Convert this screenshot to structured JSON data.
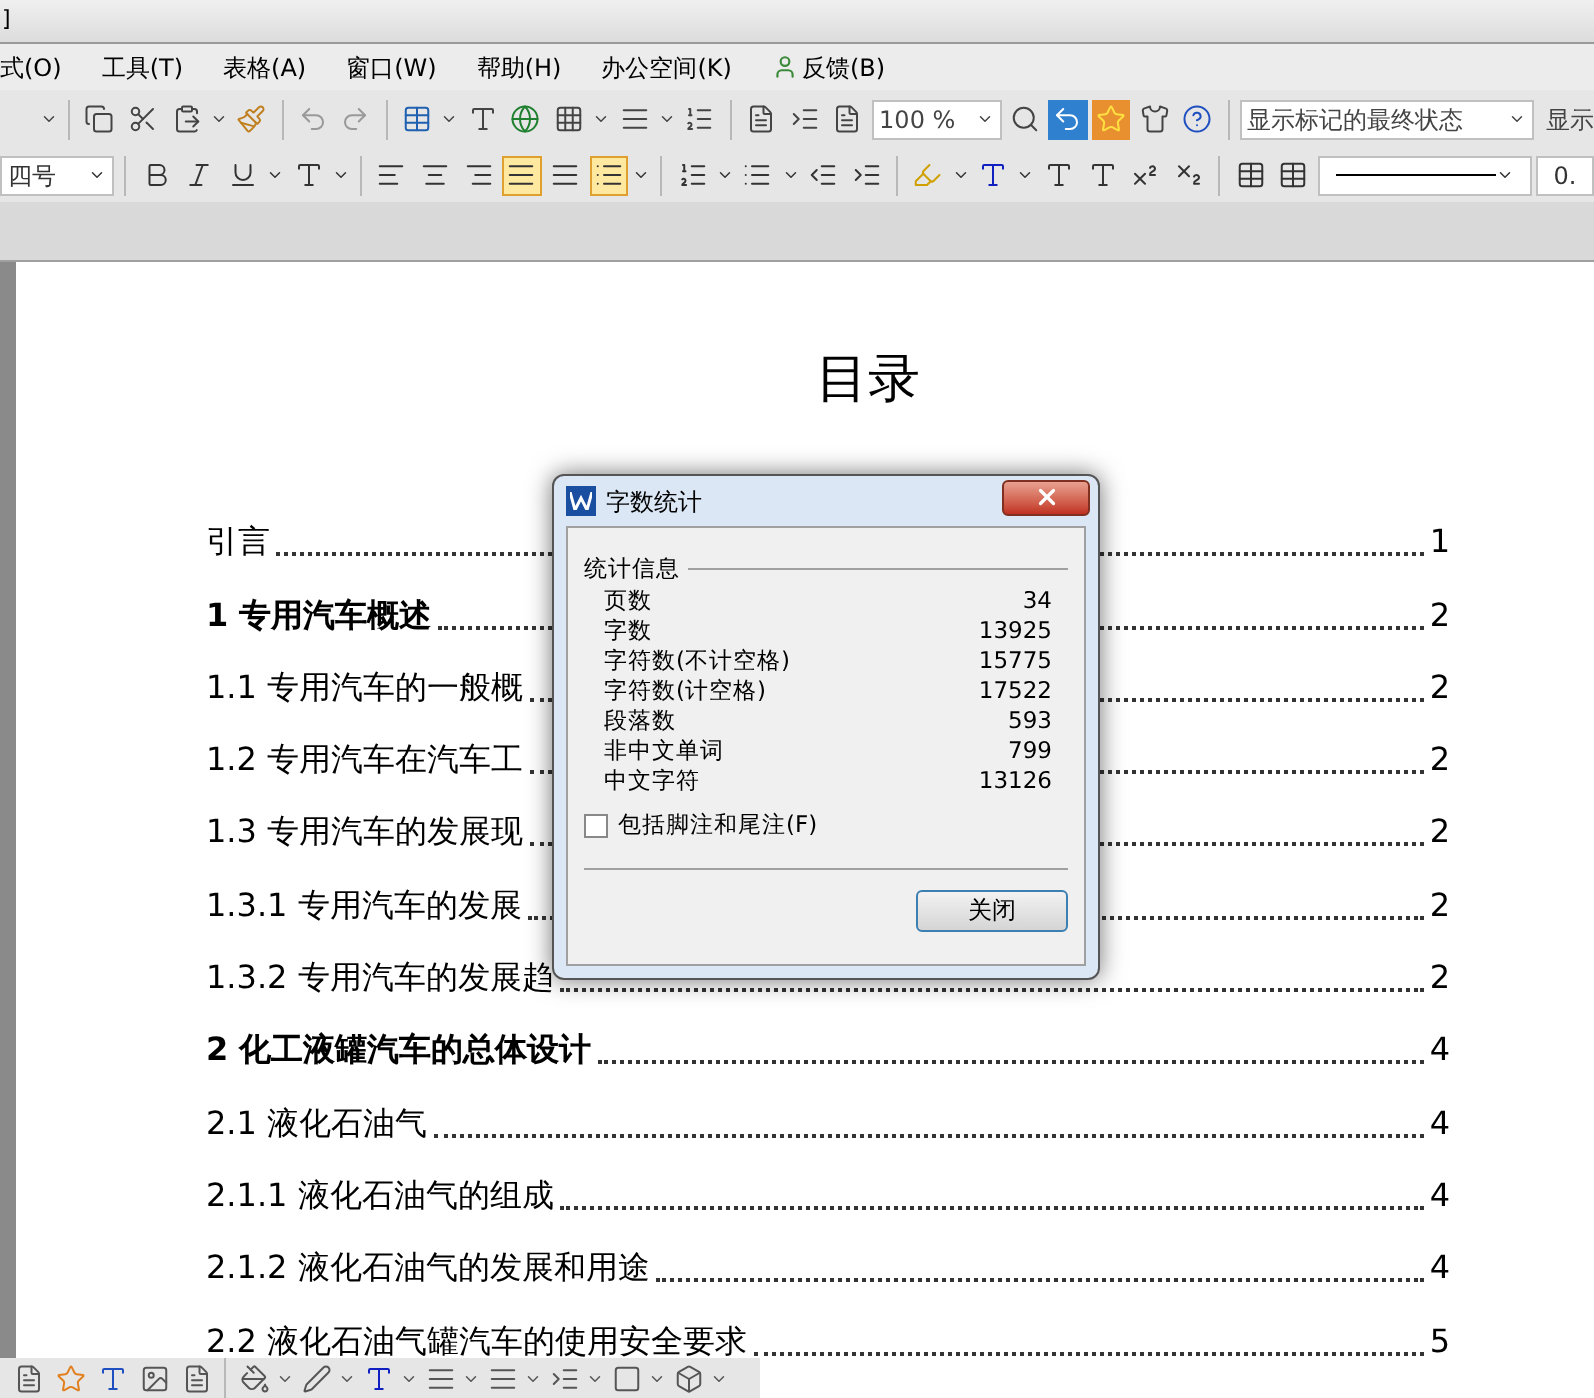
{
  "window": {
    "title": "]"
  },
  "menu": [
    "式(O)",
    "工具(T)",
    "表格(A)",
    "窗口(W)",
    "帮助(H)",
    "办公空间(K)",
    "反馈(B)"
  ],
  "toolbar": {
    "zoom": "100 %",
    "track_mode": "显示标记的最终状态",
    "track_cut": "显示"
  },
  "format_bar": {
    "font_size": "四号",
    "line_style_cut": "0."
  },
  "document": {
    "title": "目录",
    "toc": [
      {
        "text": "引言",
        "page": "1",
        "bold": false
      },
      {
        "text": "1  专用汽车概述",
        "page": "2",
        "bold": true
      },
      {
        "text": "1.1  专用汽车的一般概",
        "page": "2",
        "bold": false
      },
      {
        "text": "1.2  专用汽车在汽车工",
        "page": "2",
        "bold": false
      },
      {
        "text": "1.3  专用汽车的发展现",
        "page": "2",
        "bold": false
      },
      {
        "text": "1.3.1  专用汽车的发展",
        "page": "2",
        "bold": false
      },
      {
        "text": "1.3.2  专用汽车的发展趋",
        "page": "2",
        "bold": false
      },
      {
        "text": "2  化工液罐汽车的总体设计",
        "page": "4",
        "bold": true
      },
      {
        "text": "2.1  液化石油气",
        "page": "4",
        "bold": false
      },
      {
        "text": "2.1.1  液化石油气的组成",
        "page": "4",
        "bold": false
      },
      {
        "text": "2.1.2  液化石油气的发展和用途",
        "page": "4",
        "bold": false
      },
      {
        "text": "2.2  液化石油气罐汽车的使用安全要求",
        "page": "5",
        "bold": false
      }
    ]
  },
  "dialog": {
    "title": "字数统计",
    "group": "统计信息",
    "stats": [
      {
        "label": "页数",
        "value": "34"
      },
      {
        "label": "字数",
        "value": "13925"
      },
      {
        "label": "字符数(不计空格)",
        "value": "15775"
      },
      {
        "label": "字符数(计空格)",
        "value": "17522"
      },
      {
        "label": "段落数",
        "value": "593"
      },
      {
        "label": "非中文单词",
        "value": "799"
      },
      {
        "label": "中文字符",
        "value": "13126"
      }
    ],
    "include_footnotes": {
      "label": "包括脚注和尾注(F)",
      "checked": false
    },
    "close_button": "关闭"
  }
}
